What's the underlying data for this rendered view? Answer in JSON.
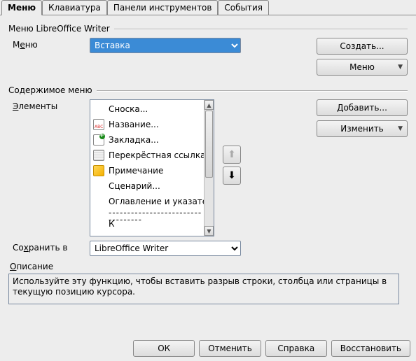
{
  "tabs": {
    "menu": "Меню",
    "keyboard": "Клавиатура",
    "toolbars": "Панели инструментов",
    "events": "События"
  },
  "fs_menu": {
    "title": "Меню LibreOffice Writer",
    "label_menu_pre": "М",
    "label_menu_u": "е",
    "label_menu_post": "ню",
    "combo_value": "Вставка",
    "btn_create": "Создать...",
    "btn_menu": "Меню"
  },
  "fs_content": {
    "title": "Содержимое меню",
    "label_elems_u": "Э",
    "label_elems_post": "лементы",
    "btn_add": "Добавить...",
    "btn_change": "Изменить",
    "items": [
      {
        "label": "Сноска..."
      },
      {
        "label": "Название..."
      },
      {
        "label": "Закладка..."
      },
      {
        "label": "Перекрёстная ссылка..."
      },
      {
        "label": "Примечание"
      },
      {
        "label": "Сценарий..."
      },
      {
        "label": "Оглавление и указатели",
        "submenu": true
      },
      {
        "sep": true
      },
      {
        "label": "К"
      }
    ]
  },
  "save_in": {
    "label_pre": "Со",
    "label_u": "х",
    "label_post": "ранить в",
    "value": "LibreOffice Writer"
  },
  "description": {
    "label_u": "О",
    "label_post": "писание",
    "text": "Используйте эту функцию, чтобы вставить разрыв строки, столбца или страницы в текущую позицию курсора."
  },
  "footer": {
    "ok": "ОК",
    "cancel": "Отменить",
    "help": "Справка",
    "reset": "Восстановить"
  }
}
